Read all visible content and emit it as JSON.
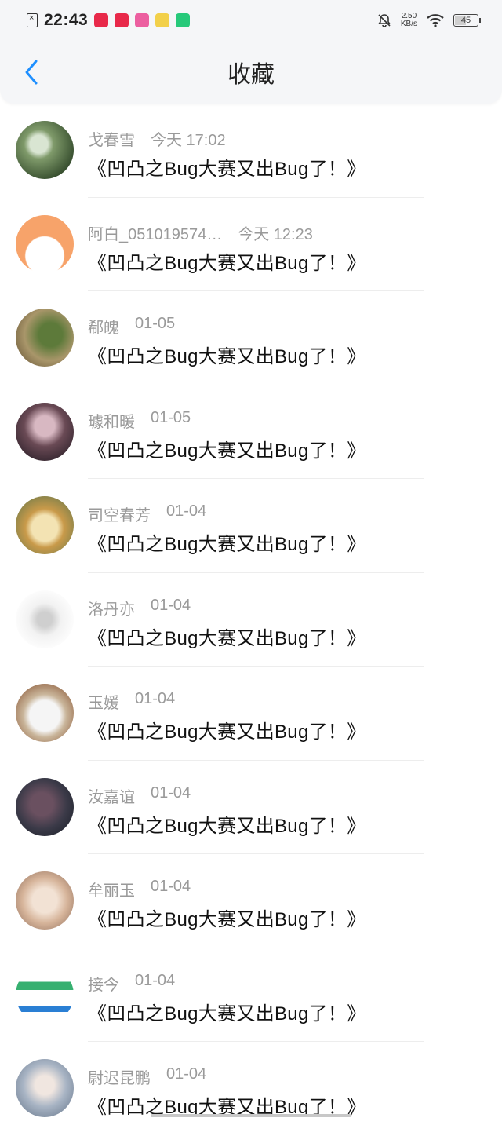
{
  "status_bar": {
    "time": "22:43",
    "net_speed_value": "2.50",
    "net_speed_unit": "KB/s",
    "battery": "45",
    "app_icons": [
      {
        "name": "app-icon-1",
        "color": "#e8294a"
      },
      {
        "name": "app-icon-2",
        "color": "#e8294a"
      },
      {
        "name": "app-icon-3",
        "color": "#ec5fa0"
      },
      {
        "name": "app-icon-4",
        "color": "#f2d04a"
      },
      {
        "name": "app-icon-5",
        "color": "#27c97a"
      }
    ]
  },
  "header": {
    "title": "收藏",
    "back_icon": "chevron-left-icon",
    "accent": "#1e8fff"
  },
  "items": [
    {
      "name": "戈春雪",
      "time": "今天 17:02",
      "title": "《凹凸之Bug大赛又出Bug了！》",
      "avatar_colors": [
        "#4c6b3c",
        "#d9e5d2"
      ]
    },
    {
      "name": "阿白_051019574…",
      "time": "今天 12:23",
      "title": "《凹凸之Bug大赛又出Bug了！》",
      "avatar_colors": [
        "#f7a36a",
        "#ffffff"
      ]
    },
    {
      "name": "郗魄",
      "time": "01-05",
      "title": "《凹凸之Bug大赛又出Bug了！》",
      "avatar_colors": [
        "#5d7a3a",
        "#c9b48a"
      ]
    },
    {
      "name": "璩和暖",
      "time": "01-05",
      "title": "《凹凸之Bug大赛又出Bug了！》",
      "avatar_colors": [
        "#3d2f3a",
        "#d8b8c2"
      ]
    },
    {
      "name": "司空春芳",
      "time": "01-04",
      "title": "《凹凸之Bug大赛又出Bug了！》",
      "avatar_colors": [
        "#c99a4a",
        "#f3e3b3"
      ]
    },
    {
      "name": "洛丹亦",
      "time": "01-04",
      "title": "《凹凸之Bug大赛又出Bug了！》",
      "avatar_colors": [
        "#f2f2f2",
        "#cfcfcf"
      ]
    },
    {
      "name": "玉媛",
      "time": "01-04",
      "title": "《凹凸之Bug大赛又出Bug了！》",
      "avatar_colors": [
        "#8c5a3a",
        "#f5f5f5"
      ]
    },
    {
      "name": "汝嘉谊",
      "time": "01-04",
      "title": "《凹凸之Bug大赛又出Bug了！》",
      "avatar_colors": [
        "#2b2f3c",
        "#6a5060"
      ]
    },
    {
      "name": "牟丽玉",
      "time": "01-04",
      "title": "《凹凸之Bug大赛又出Bug了！》",
      "avatar_colors": [
        "#e6d2c0",
        "#c7a58c"
      ]
    },
    {
      "name": "接今",
      "time": "01-04",
      "title": "《凹凸之Bug大赛又出Bug了！》",
      "avatar_colors": [
        "#ffffff",
        "#36b070"
      ]
    },
    {
      "name": "尉迟昆鹏",
      "time": "01-04",
      "title": "《凹凸之Bug大赛又出Bug了！》",
      "avatar_colors": [
        "#a8b4c4",
        "#dfe4ea"
      ]
    }
  ]
}
